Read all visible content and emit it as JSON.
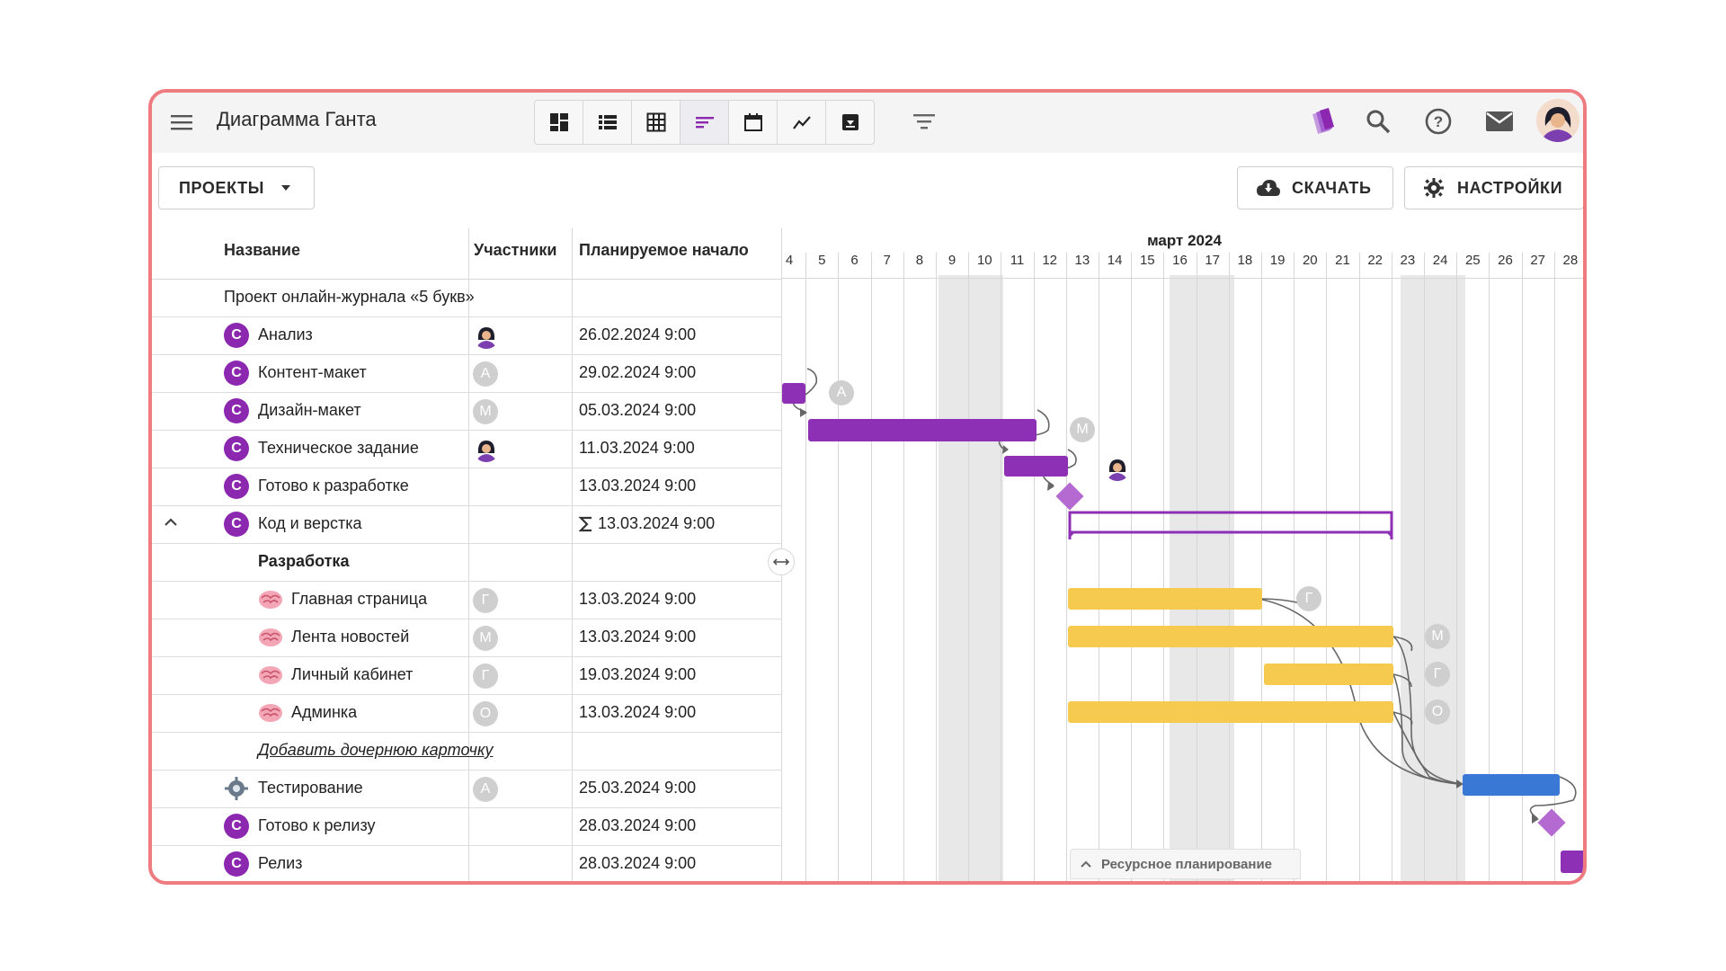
{
  "app": {
    "title": "Диаграмма Ганта"
  },
  "toolbar": {
    "projects_label": "ПРОЕКТЫ",
    "download_label": "СКАЧАТЬ",
    "settings_label": "НАСТРОЙКИ"
  },
  "table": {
    "headers": {
      "name": "Название",
      "participants": "Участники",
      "start": "Планируемое начало"
    },
    "project_title": "Проект онлайн-журнала «5 букв»",
    "rows": [
      {
        "name": "Анализ",
        "badge": "C",
        "participant": "avatar",
        "date": "26.02.2024 9:00"
      },
      {
        "name": "Контент-макет",
        "badge": "C",
        "participant": "А",
        "date": "29.02.2024 9:00"
      },
      {
        "name": "Дизайн-макет",
        "badge": "C",
        "participant": "М",
        "date": "05.03.2024 9:00"
      },
      {
        "name": "Техническое задание",
        "badge": "C",
        "participant": "avatar",
        "date": "11.03.2024 9:00"
      },
      {
        "name": "Готово к разработке",
        "badge": "C",
        "participant": "",
        "date": "13.03.2024 9:00"
      },
      {
        "name": "Код и верстка",
        "badge": "C",
        "participant": "",
        "date": "13.03.2024 9:00",
        "sum_icon": "sigma-icon"
      },
      {
        "name": "Разработка",
        "group": true
      },
      {
        "name": "Главная страница",
        "icon": "brain-icon",
        "participant": "Г",
        "date": "13.03.2024 9:00"
      },
      {
        "name": "Лента новостей",
        "icon": "brain-icon",
        "participant": "М",
        "date": "13.03.2024 9:00"
      },
      {
        "name": "Личный кабинет",
        "icon": "brain-icon",
        "participant": "Г",
        "date": "19.03.2024 9:00"
      },
      {
        "name": "Админка",
        "icon": "brain-icon",
        "participant": "О",
        "date": "13.03.2024 9:00"
      },
      {
        "name": "Добавить дочернюю карточку",
        "link": true
      },
      {
        "name": "Тестирование",
        "icon": "gear-icon",
        "participant": "А",
        "date": "25.03.2024 9:00"
      },
      {
        "name": "Готово к релизу",
        "badge": "C",
        "participant": "",
        "date": "28.03.2024 9:00"
      },
      {
        "name": "Релиз",
        "badge": "C",
        "participant": "",
        "date": "28.03.2024 9:00"
      }
    ]
  },
  "gantt": {
    "month": "март 2024",
    "days": [
      "4",
      "5",
      "6",
      "7",
      "8",
      "9",
      "10",
      "11",
      "12",
      "13",
      "14",
      "15",
      "16",
      "17",
      "18",
      "19",
      "20",
      "21",
      "22",
      "23",
      "24",
      "25",
      "26",
      "27",
      "28"
    ],
    "weekend_days": [
      "9",
      "10",
      "16",
      "17",
      "23",
      "24"
    ],
    "resource_planning_label": "Ресурсное планирование",
    "bar_labels": [
      "А",
      "М",
      "Г",
      "М",
      "Г",
      "О"
    ]
  },
  "colors": {
    "accent": "#8c27b0",
    "bar_purple": "#8e30b5",
    "bar_yellow": "#f6c94f",
    "bar_blue": "#3a78d6",
    "milestone": "#b46ad0",
    "frame": "#ee7b7f"
  }
}
